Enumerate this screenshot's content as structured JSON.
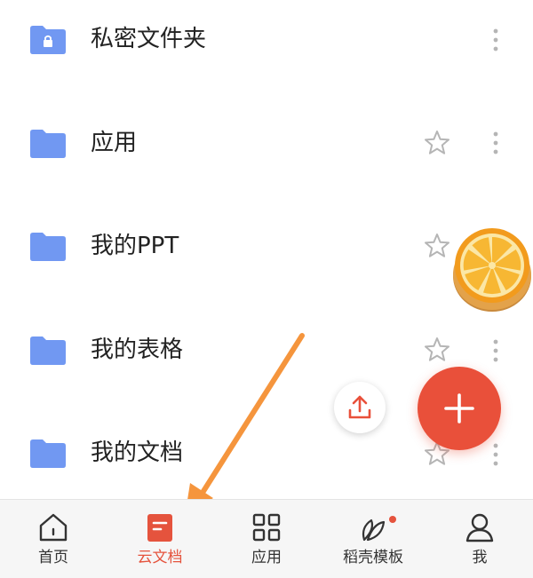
{
  "folders": [
    {
      "label": "私密文件夹",
      "icon": "lock-folder-icon",
      "starred_visible": false
    },
    {
      "label": "应用",
      "icon": "folder-icon",
      "starred_visible": true
    },
    {
      "label": "我的PPT",
      "icon": "folder-icon",
      "starred_visible": true
    },
    {
      "label": "我的表格",
      "icon": "folder-icon",
      "starred_visible": true
    },
    {
      "label": "我的文档",
      "icon": "folder-icon",
      "starred_visible": true
    }
  ],
  "nav": [
    {
      "label": "首页",
      "icon": "home-icon"
    },
    {
      "label": "云文档",
      "icon": "cloud-doc-icon",
      "active": true
    },
    {
      "label": "应用",
      "icon": "apps-grid-icon"
    },
    {
      "label": "稻壳模板",
      "icon": "template-leaf-icon",
      "badge": true
    },
    {
      "label": "我",
      "icon": "user-icon"
    }
  ],
  "colors": {
    "folder": "#7198f2",
    "accent": "#e9503a",
    "active_nav": "#e5533d",
    "annotation_arrow": "#f5953d"
  }
}
